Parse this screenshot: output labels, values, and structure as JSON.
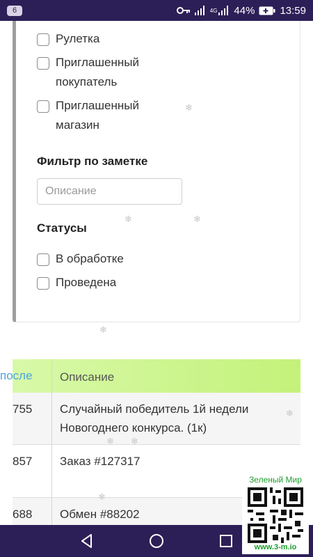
{
  "status_bar": {
    "notification_count": "6",
    "network": "4G",
    "battery": "44%",
    "time": "13:59",
    "icons": [
      "key-icon",
      "signal-icon",
      "battery-icon"
    ]
  },
  "filters": {
    "type_options": [
      {
        "label": "Рулетка",
        "checked": false
      },
      {
        "label": "Приглашенный покупатель",
        "checked": false
      },
      {
        "label": "Приглашенный магазин",
        "checked": false
      }
    ],
    "note_filter": {
      "title": "Фильтр по заметке",
      "placeholder": "Описание",
      "value": ""
    },
    "statuses": {
      "title": "Статусы",
      "options": [
        {
          "label": "В обработке",
          "checked": false
        },
        {
          "label": "Проведена",
          "checked": false
        }
      ]
    }
  },
  "table": {
    "columns": [
      "после",
      "Описание"
    ],
    "rows": [
      {
        "balance": "755",
        "description": "Случайный победитель 1й недели Новогоднего конкурса. (1к)"
      },
      {
        "balance": "857",
        "description": "Заказ #127317"
      },
      {
        "balance": "688",
        "description": "Обмен #88202"
      }
    ]
  },
  "watermark": {
    "title": "Зеленый Мир",
    "url": "www.3-m.io"
  },
  "colors": {
    "status_bar": "#2c1f57",
    "table_header": "#c3f27a",
    "link_blue": "#4aa3e0",
    "watermark_green": "#1e9e2e"
  }
}
